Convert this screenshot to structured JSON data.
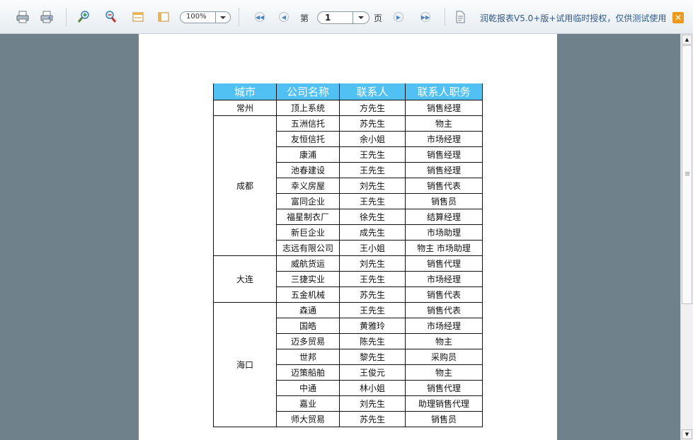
{
  "toolbar": {
    "zoom_value": "100%",
    "page_label_before": "第",
    "page_value": "1",
    "page_label_after": "页",
    "notice": "润乾报表V5.0+版+试用临时授权，仅供测试使用"
  },
  "report": {
    "headers": [
      "城市",
      "公司名称",
      "联系人",
      "联系人职务"
    ],
    "groups": [
      {
        "city": "常州",
        "rows": [
          [
            "顶上系统",
            "方先生",
            "销售经理"
          ]
        ]
      },
      {
        "city": "成都",
        "rows": [
          [
            "五洲信托",
            "苏先生",
            "物主"
          ],
          [
            "友恒信托",
            "余小姐",
            "市场经理"
          ],
          [
            "康浦",
            "王先生",
            "销售经理"
          ],
          [
            "池春建设",
            "王先生",
            "销售经理"
          ],
          [
            "幸义房屋",
            "刘先生",
            "销售代表"
          ],
          [
            "富同企业",
            "王先生",
            "销售员"
          ],
          [
            "福星制衣厂",
            "徐先生",
            "结算经理"
          ],
          [
            "新巨企业",
            "成先生",
            "市场助理"
          ],
          [
            "志远有限公司",
            "王小姐",
            "物主 市场助理"
          ]
        ]
      },
      {
        "city": "大连",
        "rows": [
          [
            "威航货运",
            "刘先生",
            "销售代理"
          ],
          [
            "三捷实业",
            "王先生",
            "市场经理"
          ],
          [
            "五金机械",
            "苏先生",
            "销售代表"
          ]
        ]
      },
      {
        "city": "海口",
        "rows": [
          [
            "森通",
            "王先生",
            "销售代表"
          ],
          [
            "国皓",
            "黄雅玲",
            "市场经理"
          ],
          [
            "迈多贸易",
            "陈先生",
            "物主"
          ],
          [
            "世邦",
            "黎先生",
            "采购员"
          ],
          [
            "迈策船舶",
            "王俊元",
            "物主"
          ],
          [
            "中通",
            "林小姐",
            "销售代理"
          ],
          [
            "嘉业",
            "刘先生",
            "助理销售代理"
          ],
          [
            "师大贸易",
            "苏先生",
            "销售员"
          ]
        ]
      }
    ]
  }
}
